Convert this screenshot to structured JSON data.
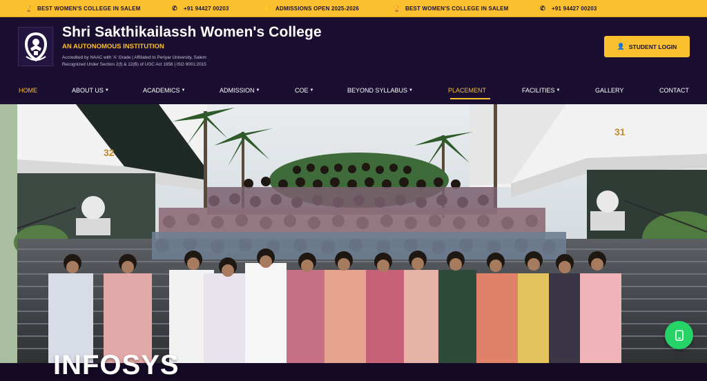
{
  "ticker": {
    "items": [
      {
        "icon": "trophy-icon",
        "text": "BEST WOMEN'S COLLEGE IN SALEM"
      },
      {
        "icon": "phone-icon",
        "text": "+91 94427 00203"
      },
      {
        "icon": "lightning-icon",
        "text": "ADMISSIONS OPEN 2025-2026"
      },
      {
        "icon": "trophy-icon",
        "text": "BEST WOMEN'S COLLEGE IN SALEM"
      },
      {
        "icon": "phone-icon",
        "text": "+91 94427 00203"
      }
    ]
  },
  "header": {
    "college_name": "Shri Sakthikailassh Women's College",
    "tagline": "AN AUTONOMOUS INSTITUTION",
    "accreditation_line1": "Accredited by NAAC with 'A' Grade | Affiliated to Periyar University, Salem",
    "accreditation_line2": "Recognized Under Section 2(f) & 12(B) of UGC Act 1956 | ISO 9001:2015",
    "login_label": "STUDENT LOGIN"
  },
  "nav": {
    "items": [
      {
        "label": "HOME",
        "dropdown": false
      },
      {
        "label": "ABOUT US",
        "dropdown": true
      },
      {
        "label": "ACADEMICS",
        "dropdown": true
      },
      {
        "label": "ADMISSION",
        "dropdown": true
      },
      {
        "label": "COE",
        "dropdown": true
      },
      {
        "label": "BEYOND SYLLABUS",
        "dropdown": true
      },
      {
        "label": "PLACEMENT",
        "dropdown": false
      },
      {
        "label": "FACILITIES",
        "dropdown": true
      },
      {
        "label": "GALLERY",
        "dropdown": false
      },
      {
        "label": "CONTACT",
        "dropdown": false
      }
    ]
  },
  "hero": {
    "caption": "INFOSYS",
    "building_numbers": [
      "32",
      "31"
    ]
  },
  "colors": {
    "accent": "#fbc02d",
    "header_bg": "#1a0f30",
    "whatsapp": "#25d366"
  }
}
